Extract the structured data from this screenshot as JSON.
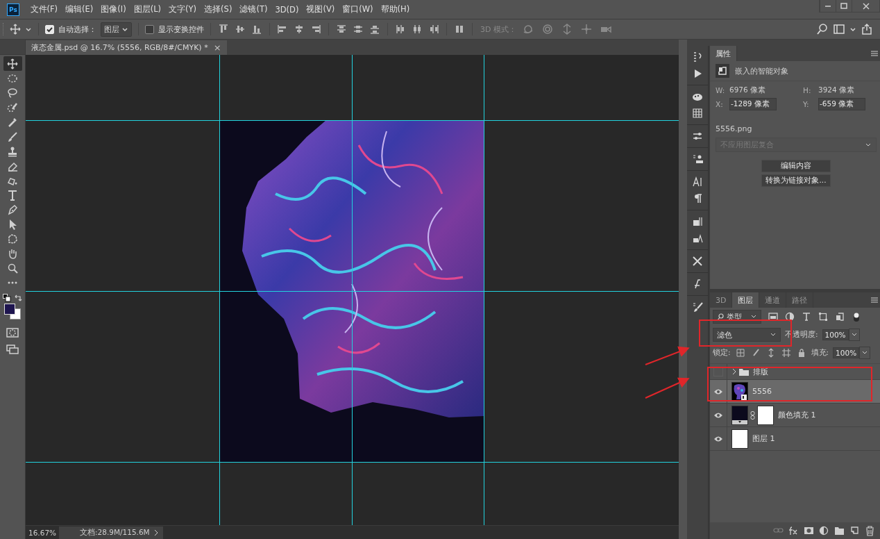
{
  "window": {
    "app_logo": "Ps"
  },
  "menu": [
    "文件(F)",
    "编辑(E)",
    "图像(I)",
    "图层(L)",
    "文字(Y)",
    "选择(S)",
    "滤镜(T)",
    "3D(D)",
    "视图(V)",
    "窗口(W)",
    "帮助(H)"
  ],
  "options_bar": {
    "auto_select": {
      "label": "自动选择：",
      "checked": true
    },
    "auto_select_target": "图层",
    "show_transform": {
      "label": "显示变换控件",
      "checked": false
    },
    "mode_3d_label": "3D 模式："
  },
  "document_tab": {
    "title": "液态金属.psd @ 16.7% (5556, RGB/8#/CMYK) *",
    "close": "×"
  },
  "tools": [
    {
      "kind": "move",
      "selected": true
    },
    {
      "kind": "marquee",
      "selected": false
    },
    {
      "kind": "lasso",
      "selected": false
    },
    {
      "kind": "quick-select",
      "selected": false
    },
    {
      "kind": "eyedropper",
      "selected": false
    },
    {
      "kind": "brush",
      "selected": false
    },
    {
      "kind": "stamp",
      "selected": false
    },
    {
      "kind": "eraser",
      "selected": false
    },
    {
      "kind": "fill",
      "selected": false
    },
    {
      "kind": "type",
      "selected": false
    },
    {
      "kind": "pen",
      "selected": false
    },
    {
      "kind": "path-select",
      "selected": false
    },
    {
      "kind": "shape",
      "selected": false
    },
    {
      "kind": "hand",
      "selected": false
    },
    {
      "kind": "zoom",
      "selected": false
    },
    {
      "kind": "more",
      "selected": false
    }
  ],
  "status_bar": {
    "zoom": "16.67%",
    "doc_info": "文档:28.9M/115.6M"
  },
  "properties": {
    "tab": "属性",
    "object_type": "嵌入的智能对象",
    "w_label": "W:",
    "w": "6976 像素",
    "h_label": "H:",
    "h": "3924 像素",
    "x_label": "X:",
    "x": "-1289 像素",
    "y_label": "Y:",
    "y": "-659 像素",
    "file": "5556.png",
    "layer_comp": {
      "value": "不应用图层复合",
      "disabled": true
    },
    "buttons": [
      "编辑内容",
      "转换为链接对象..."
    ]
  },
  "layers_panel": {
    "tabs": [
      {
        "label": "3D",
        "selected": false
      },
      {
        "label": "图层",
        "selected": true
      },
      {
        "label": "通道",
        "selected": false
      },
      {
        "label": "路径",
        "selected": false
      }
    ],
    "filter_label": "类型",
    "blend_mode": "滤色",
    "opacity_label": "不透明度:",
    "opacity": "100%",
    "lock_label": "锁定:",
    "fill_label": "填充:",
    "fill": "100%",
    "layers": [
      {
        "name": "排版",
        "kind": "group",
        "visible": false,
        "expanded": false,
        "selected": false
      },
      {
        "name": "5556",
        "kind": "smart",
        "visible": true,
        "selected": true
      },
      {
        "name": "颜色填充 1",
        "kind": "fill",
        "visible": true,
        "selected": false
      },
      {
        "name": "图层 1",
        "kind": "pixel",
        "visible": true,
        "selected": false
      }
    ]
  }
}
